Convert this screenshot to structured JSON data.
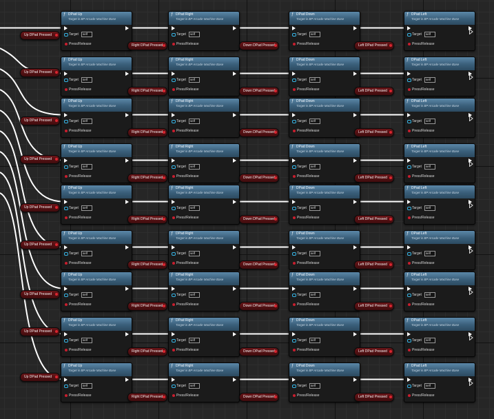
{
  "graph": {
    "subtitle": "Target is BP Arcade Machine Base",
    "target_label": "Target",
    "target_value": "self",
    "press_label": "Press/Release",
    "functions": [
      "DPad Up",
      "DPad Right",
      "DPad Down",
      "DPad Left"
    ],
    "variables": [
      "Up DPad Pressed",
      "Right DPad Pressed",
      "Down DPad Pressed",
      "Left DPad Pressed"
    ],
    "row_count": 9,
    "icon": "function-icon",
    "colors": {
      "background": "#262626",
      "node_header": "#3a5f7a",
      "exec_wire": "#ffffff",
      "bool_pin": "#c81e2e",
      "object_pin": "#37b5e6"
    }
  }
}
